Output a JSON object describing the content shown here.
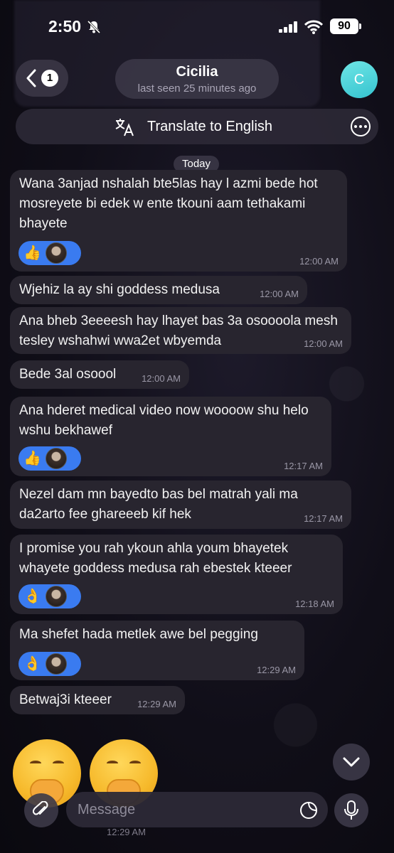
{
  "status_bar": {
    "time": "2:50",
    "battery": "90"
  },
  "header": {
    "back_count": "1",
    "contact_name": "Cicilia",
    "last_seen": "last seen 25 minutes ago",
    "avatar_initial": "C",
    "avatar_color": "#44cdd6"
  },
  "translate_bar": {
    "label": "Translate to English"
  },
  "date_label": "Today",
  "messages": [
    {
      "text": "Wana 3anjad nshalah bte5las hay l azmi bede hot mosreyete bi edek w ente tkouni aam tethakami bhayete",
      "time": "12:00 AM",
      "reaction_emoji": "👍"
    },
    {
      "text": "Wjehiz la ay shi goddess medusa",
      "time": "12:00 AM"
    },
    {
      "text": "Ana bheb 3eeeesh hay lhayet bas 3a osoooola mesh tesley wshahwi wwa2et wbyemda",
      "time": "12:00 AM"
    },
    {
      "text": "Bede 3al osoool",
      "time": "12:00 AM"
    },
    {
      "text": "Ana hderet medical video now woooow shu helo wshu bekhawef",
      "time": "12:17 AM",
      "reaction_emoji": "👍"
    },
    {
      "text": "Nezel dam mn bayedto bas bel matrah yali ma da2arto fee ghareeeb kif hek",
      "time": "12:17 AM"
    },
    {
      "text": "I promise you rah ykoun ahla youm bhayetek whayete goddess medusa rah ebestek kteeer",
      "time": "12:18 AM",
      "reaction_emoji": "👌"
    },
    {
      "text": "Ma shefet hada metlek awe bel pegging",
      "time": "12:29 AM",
      "reaction_emoji": "👌"
    },
    {
      "text": "Betwaj3i kteeer",
      "time": "12:29 AM"
    }
  ],
  "bottom_time": "12:29 AM",
  "input": {
    "placeholder": "Message"
  },
  "colors": {
    "reaction_bg": "#3a7bf0",
    "bubble_bg": "#28252f"
  }
}
